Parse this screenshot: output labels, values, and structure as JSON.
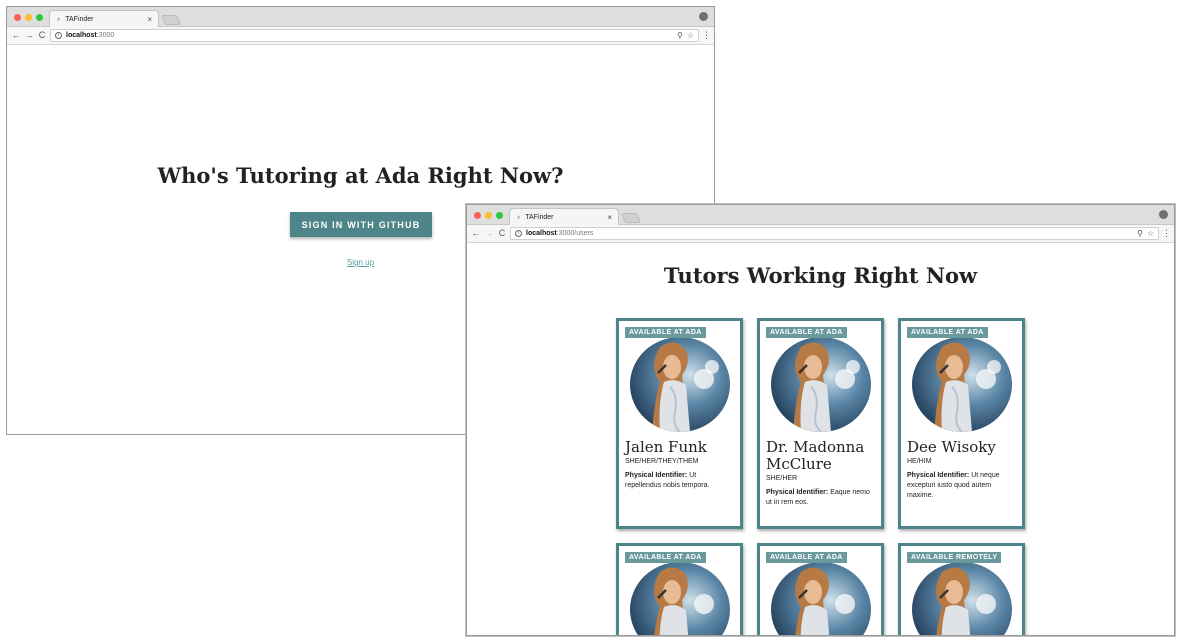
{
  "window1": {
    "tab_title": "TAFinder",
    "tab_close": "×",
    "url_host": "localhost",
    "url_rest": ":3000",
    "heading": "Who's Tutoring at Ada Right Now?",
    "signin_label": "SIGN IN WITH GITHUB",
    "signup_label": "Sign up"
  },
  "window2": {
    "tab_title": "TAFinder",
    "tab_close": "×",
    "url_host": "localhost",
    "url_rest": ":3000/users",
    "heading": "Tutors Working Right Now",
    "identifier_label": "Physical Identifier:",
    "cards": [
      {
        "badge": "AVAILABLE AT ADA",
        "name": "Jalen Funk",
        "pronouns": "SHE/HER/THEY/THEM",
        "identifier": "Ut repellendus nobis tempora."
      },
      {
        "badge": "AVAILABLE AT ADA",
        "name": "Dr. Madonna McClure",
        "pronouns": "SHE/HER",
        "identifier": "Eaque nemo ut in rem eos."
      },
      {
        "badge": "AVAILABLE AT ADA",
        "name": "Dee Wisoky",
        "pronouns": "HE/HIM",
        "identifier": "Ut neque excepturi iusto quod autem maxime."
      },
      {
        "badge": "AVAILABLE AT ADA"
      },
      {
        "badge": "AVAILABLE AT ADA"
      },
      {
        "badge": "AVAILABLE REMOTELY"
      }
    ]
  },
  "icons": {
    "back": "←",
    "forward": "→",
    "reload": "C",
    "info": "i",
    "zoom": "⚲",
    "star": "☆",
    "menu": "⋮",
    "favicon": "♁"
  },
  "colors": {
    "accent": "#4e8588",
    "badge": "#6b9a9d",
    "link": "#5a9da0",
    "card_border": "#4d8489"
  }
}
